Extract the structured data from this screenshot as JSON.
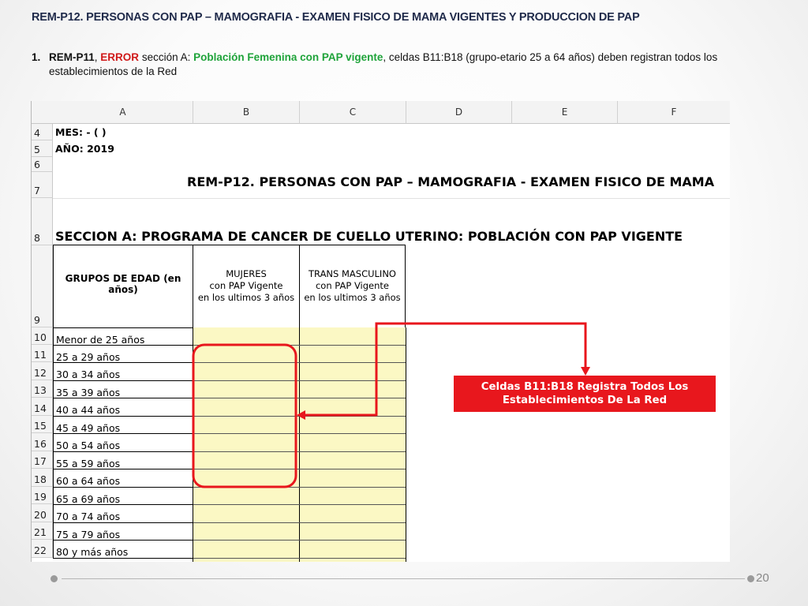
{
  "slide": {
    "title": "REM-P12. PERSONAS CON PAP – MAMOGRAFIA - EXAMEN FISICO DE MAMA VIGENTES Y PRODUCCION DE PAP",
    "note": {
      "number": "1.",
      "code": "REM-P11",
      "sep": ", ",
      "error": "ERROR",
      "mid": " sección A: ",
      "highlight": "Población Femenina con PAP vigente",
      "rest": ", celdas B11:B18 (grupo-etario 25 a 64 años) deben registran todos los",
      "line2": "establecimientos de la Red"
    },
    "page_number": "20"
  },
  "sheet": {
    "columns": [
      "A",
      "B",
      "C",
      "D",
      "E",
      "F"
    ],
    "rows": [
      "4",
      "5",
      "6",
      "7",
      "8",
      "9",
      "10",
      "11",
      "12",
      "13",
      "14",
      "15",
      "16",
      "17",
      "18",
      "19",
      "20",
      "21",
      "22"
    ],
    "mes": "MES:  - (  )",
    "anio": "AÑO: 2019",
    "report_title": "REM-P12. PERSONAS CON PAP – MAMOGRAFIA - EXAMEN FISICO DE MAMA",
    "section_title": "SECCION A: PROGRAMA DE CANCER DE CUELLO UTERINO: POBLACIÓN CON PAP VIGENTE",
    "header_a": "GRUPOS DE EDAD (en años)",
    "header_b": [
      "MUJERES",
      "con PAP Vigente",
      "en los ultimos 3 años"
    ],
    "header_c": [
      "TRANS MASCULINO",
      "con PAP Vigente",
      "en los ultimos 3 años"
    ],
    "age_groups": [
      "Menor de 25 años",
      "25 a 29 años",
      "30 a 34 años",
      "35 a 39 años",
      "40 a 44 años",
      "45 a 49 años",
      "50 a 54 años",
      "55 a 59 años",
      "60 a 64 años",
      "65 a 69 años",
      "70 a 74 años",
      "75 a 79 años",
      "80 y más años"
    ]
  },
  "callout": {
    "line1": "Celdas B11:B18 Registra Todos Los",
    "line2": "Establecimientos De La Red"
  },
  "colors": {
    "accent_red": "#e8171d",
    "cell_yellow": "#fbf8c4",
    "green": "#1fa33a",
    "title_navy": "#1f2a4a"
  }
}
